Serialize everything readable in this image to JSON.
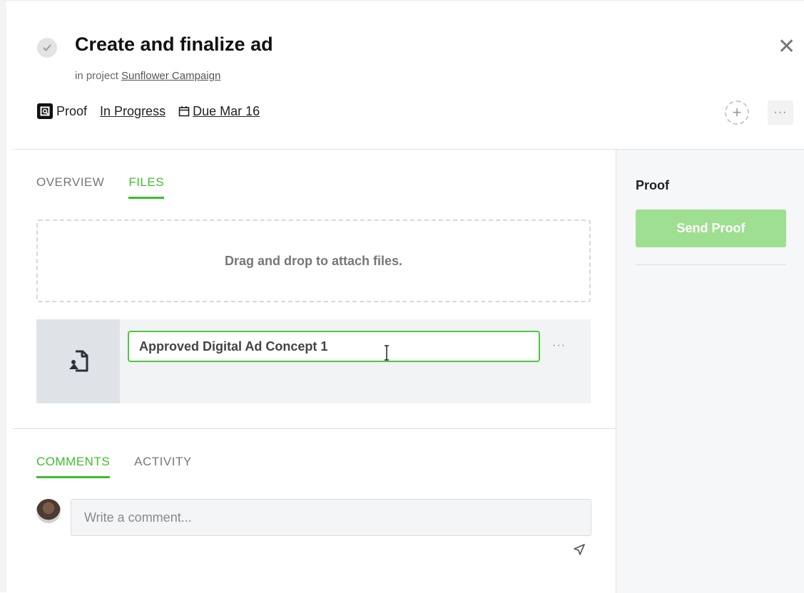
{
  "header": {
    "title": "Create and finalize ad",
    "subtitle_prefix": "in project",
    "project_name": "Sunflower Campaign",
    "type_label": "Proof",
    "status": "In Progress",
    "due": "Due Mar 16",
    "more_label": "···",
    "close_label": "✕",
    "add_label": "+"
  },
  "tabs": [
    {
      "label": "OVERVIEW",
      "active": false
    },
    {
      "label": "FILES",
      "active": true
    }
  ],
  "files": {
    "dropzone_text": "Drag and drop to attach files.",
    "items": [
      {
        "name": "Approved Digital Ad Concept 1"
      }
    ],
    "more_label": "···"
  },
  "comments_tabs": [
    {
      "label": "COMMENTS",
      "active": true
    },
    {
      "label": "ACTIVITY",
      "active": false
    }
  ],
  "comment": {
    "placeholder": "Write a comment..."
  },
  "sidebar": {
    "title": "Proof",
    "button_label": "Send Proof"
  },
  "colors": {
    "accent": "#3bbf2a",
    "button_disabled": "#9fdf92"
  }
}
